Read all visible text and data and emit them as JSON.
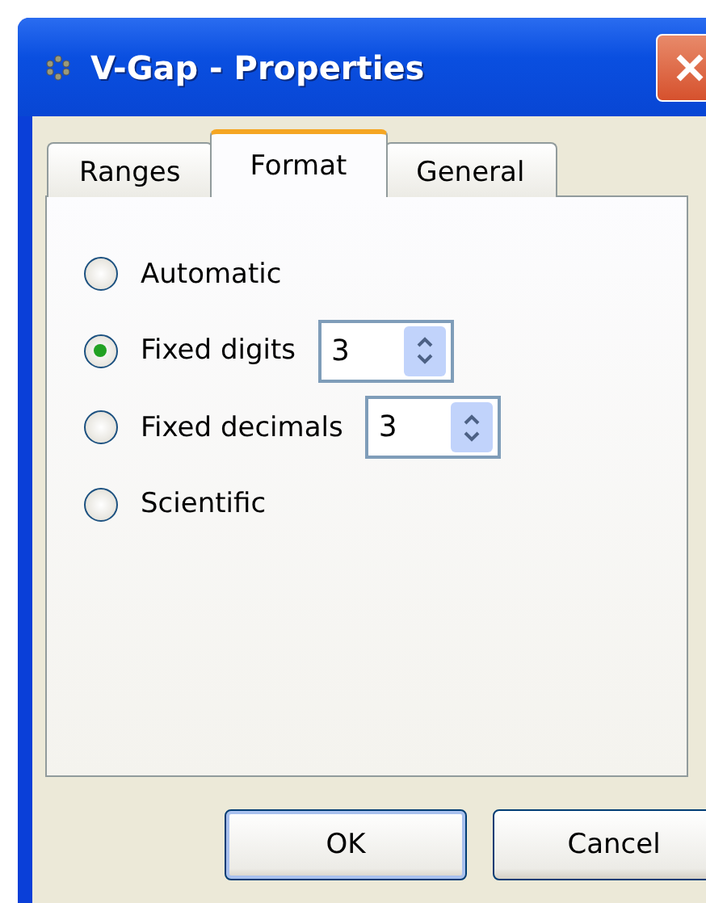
{
  "window": {
    "title": "V-Gap - Properties"
  },
  "tabs": [
    {
      "label": "Ranges",
      "selected": false
    },
    {
      "label": "Format",
      "selected": true
    },
    {
      "label": "General",
      "selected": false
    }
  ],
  "options": [
    {
      "label": "Automatic",
      "selected": false
    },
    {
      "label": "Fixed digits",
      "selected": true,
      "spinner": {
        "value": "3"
      }
    },
    {
      "label": "Fixed decimals",
      "selected": false,
      "spinner": {
        "value": "3"
      }
    },
    {
      "label": "Scientific",
      "selected": false
    }
  ],
  "buttons": [
    {
      "label": "OK",
      "default": true
    },
    {
      "label": "Cancel",
      "default": false
    }
  ]
}
